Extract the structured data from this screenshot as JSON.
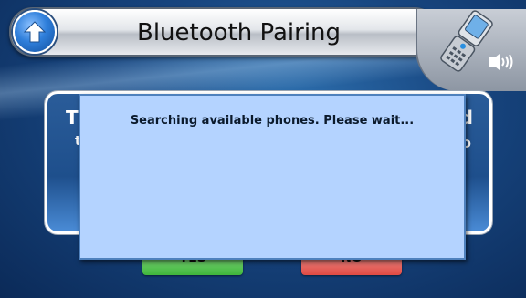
{
  "header": {
    "title": "Bluetooth Pairing",
    "back_icon": "up-arrow-icon",
    "device_icon": "flip-phone-icon",
    "signal_icon": "bluetooth-signal-icon"
  },
  "dialog": {
    "partial_left_line1": "T",
    "partial_left_line2": "t",
    "partial_right_line1": "d",
    "partial_right_line2": "o",
    "yes_label": "YES",
    "no_label": "NO"
  },
  "message": {
    "text": "Searching available phones. Please wait..."
  },
  "colors": {
    "message_bg": "#b4d3ff",
    "yes": "#3fb63b",
    "no": "#e04a43",
    "accent": "#2f7fdb"
  }
}
